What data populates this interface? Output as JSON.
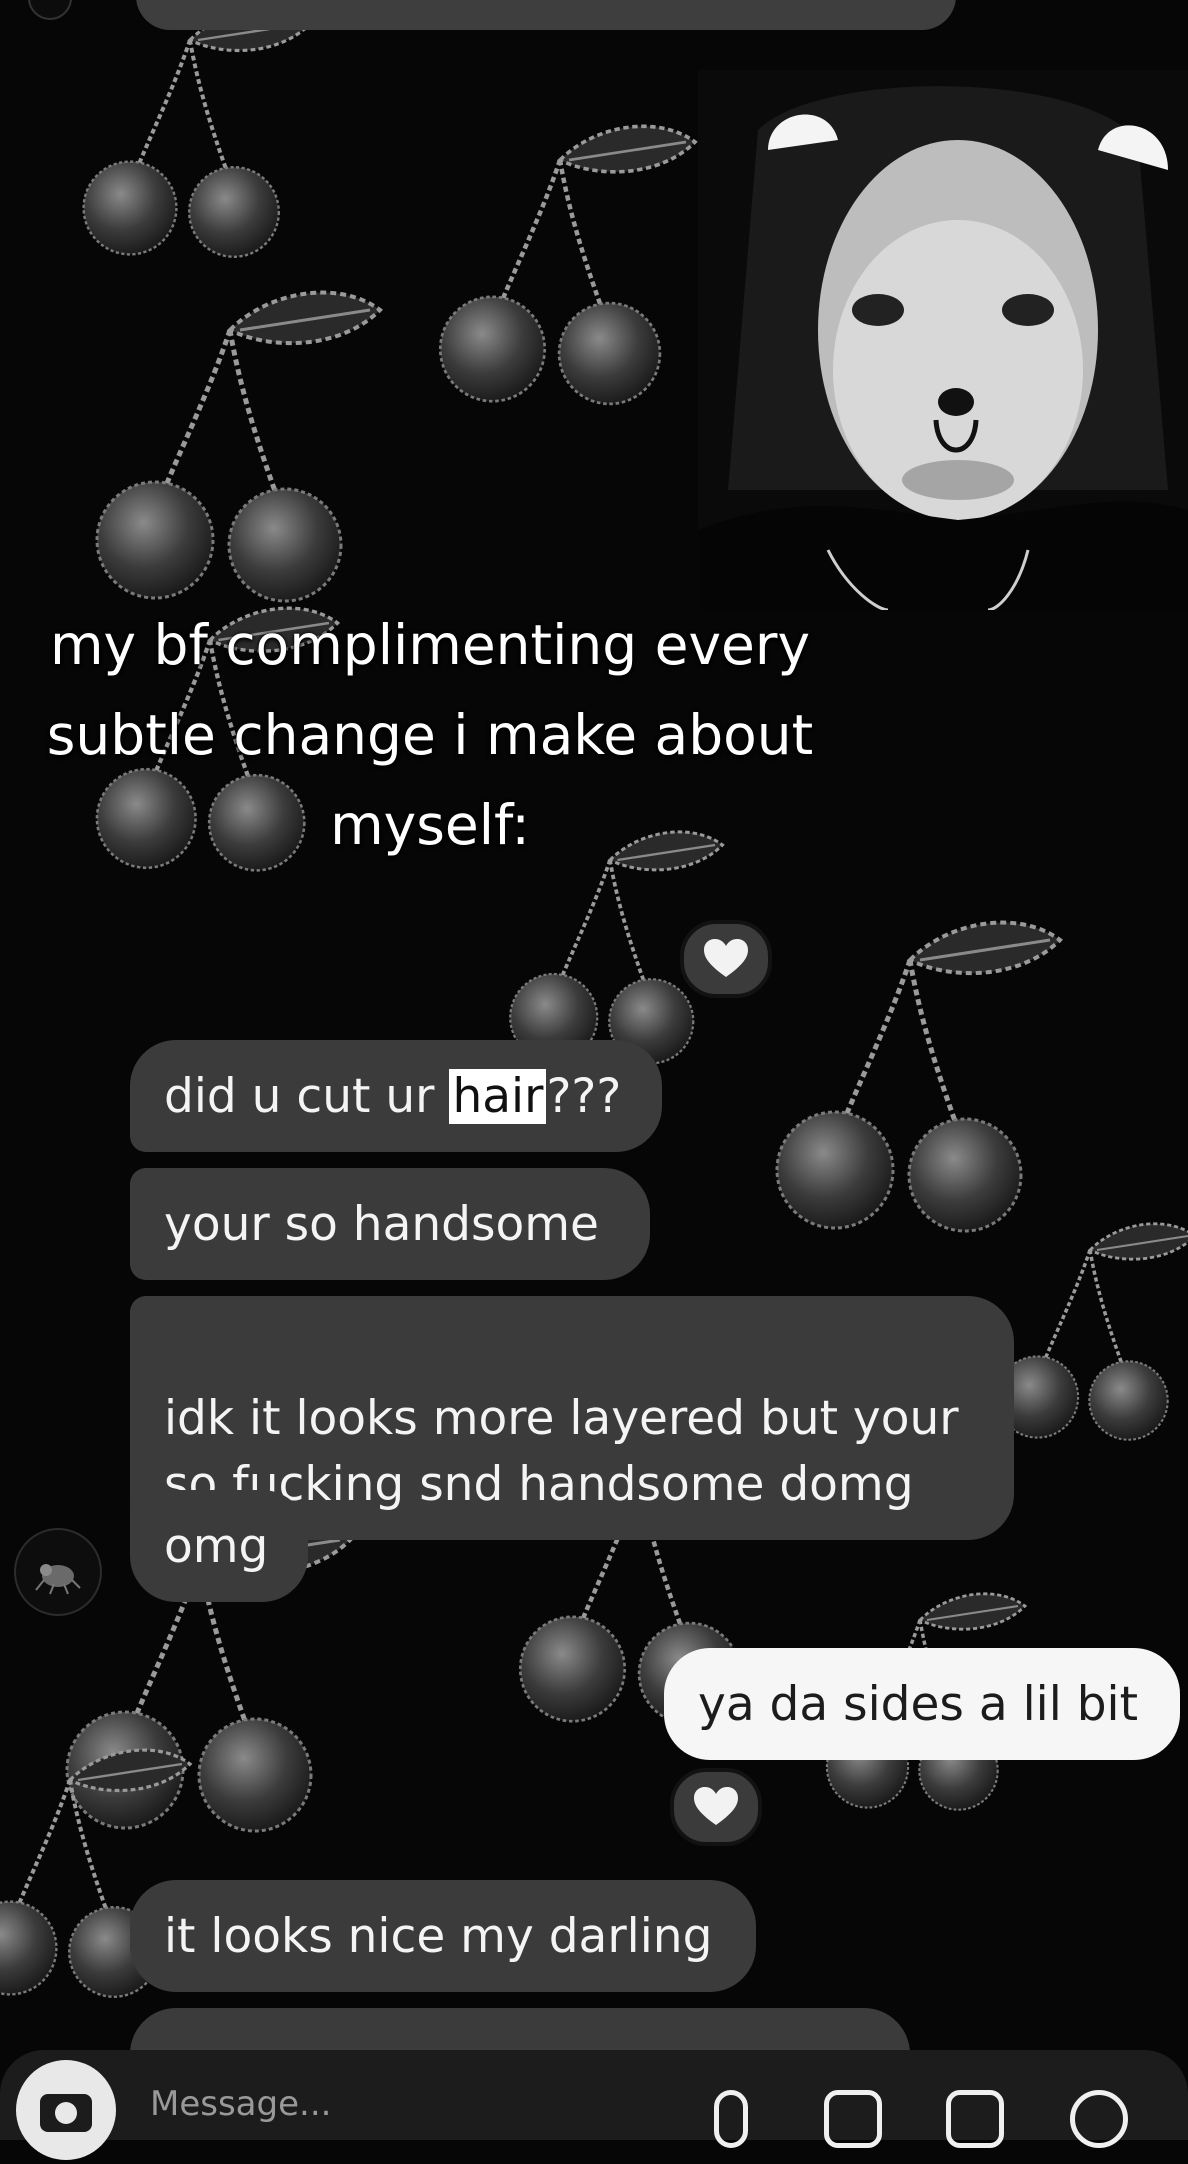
{
  "caption": "my bf complimenting every\nsubtle change i make about\nmyself:",
  "colors": {
    "background": "#060606",
    "incoming_bubble": "#3b3b3b",
    "outgoing_bubble": "#f6f6f6",
    "caption_text": "#ffffff"
  },
  "chat": {
    "messages": [
      {
        "sender": "them",
        "before": "did u cut ur ",
        "highlight": "hair",
        "after": "???"
      },
      {
        "sender": "them",
        "text": "your so handsome"
      },
      {
        "sender": "them",
        "text": "idk it looks more layered but your\nso fucking snd handsome domg"
      },
      {
        "sender": "them",
        "text": "omg"
      },
      {
        "sender": "me",
        "text": "ya da sides a lil bit"
      },
      {
        "sender": "them",
        "text": "it looks nice my darling"
      }
    ],
    "reactions": [
      {
        "icon": "heart-icon",
        "color": "#f2f2f2"
      },
      {
        "icon": "heart-icon",
        "color": "#f2f2f2"
      }
    ]
  },
  "composer": {
    "placeholder": "Message...",
    "icons": [
      "camera-icon",
      "microphone-icon",
      "gallery-icon",
      "sticker-icon",
      "add-icon"
    ]
  }
}
